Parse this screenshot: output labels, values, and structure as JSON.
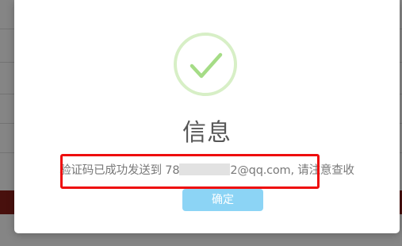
{
  "dialog": {
    "title": "信息",
    "message_prefix": "验证码已成功发送到 78",
    "message_suffix": "2@qq.com, 请注意查收",
    "confirm_label": "确定",
    "icon": "checkmark-success-icon"
  },
  "colors": {
    "success_ring": "#d7efc6",
    "success_check": "#a5dc86",
    "confirm_button": "#8cd4f5",
    "highlight_border": "#ee0d0d",
    "title_text": "#575757",
    "message_text": "#797979"
  }
}
